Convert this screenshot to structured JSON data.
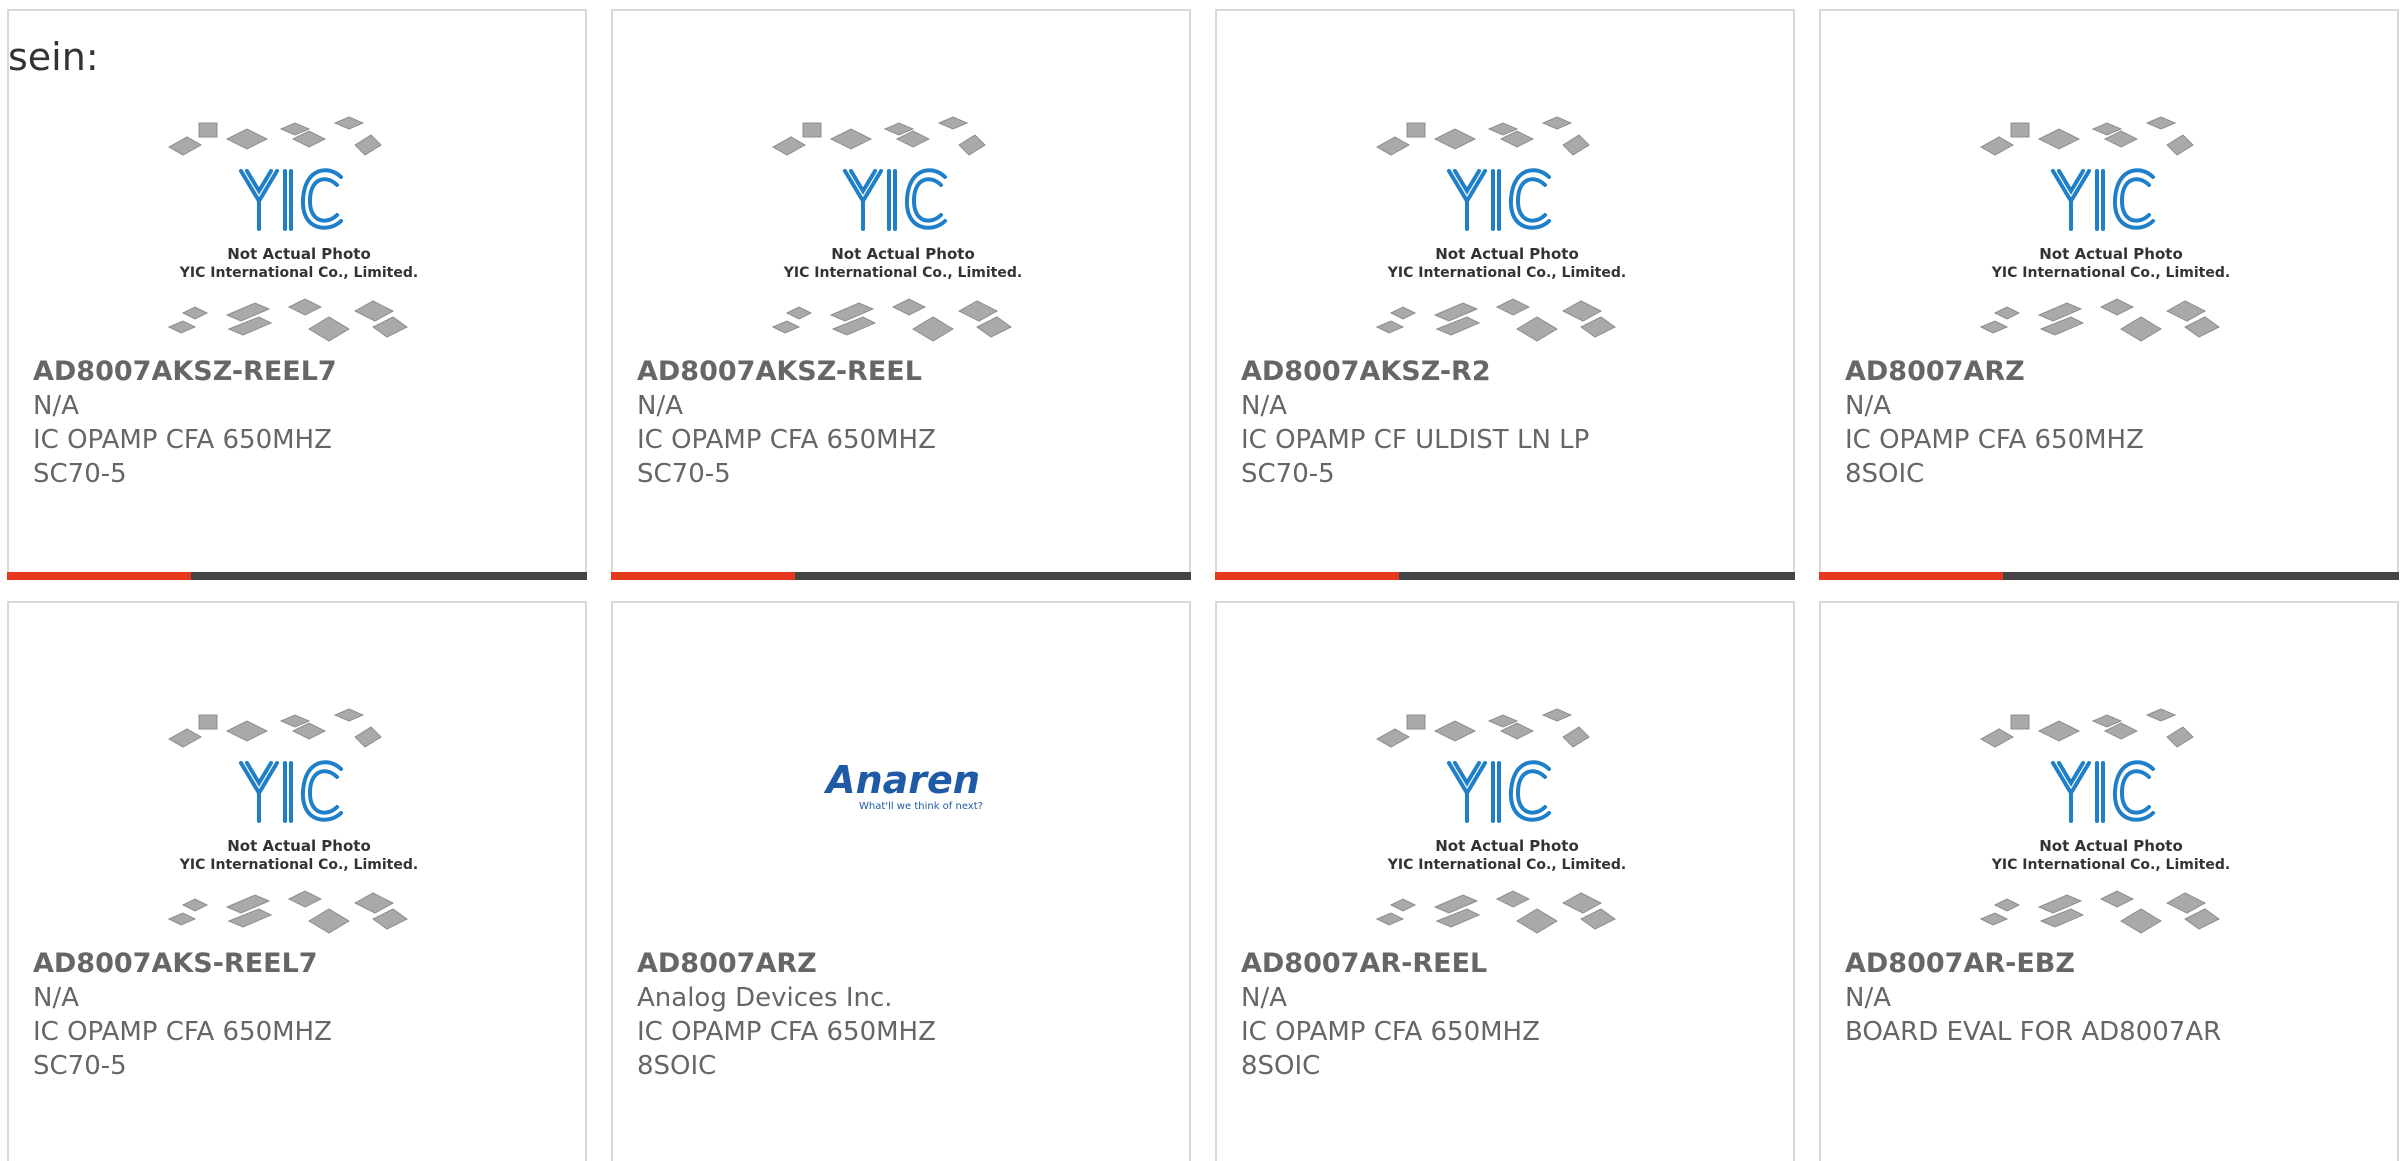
{
  "intro_text": "sein:",
  "accent_color": "#e8391c",
  "bar_color": "#444444",
  "placeholder": {
    "line1": "Not Actual Photo",
    "line2": "YIC International Co., Limited.",
    "logo": "YIC"
  },
  "anaren": {
    "logo": "Anaren",
    "tagline": "What'll we think of next?"
  },
  "products": [
    {
      "part": "AD8007AKSZ-REEL7",
      "manufacturer": "N/A",
      "description": "IC OPAMP CFA 650MHZ SC70-5",
      "image": "yic-placeholder"
    },
    {
      "part": "AD8007AKSZ-REEL",
      "manufacturer": "N/A",
      "description": "IC OPAMP CFA 650MHZ SC70-5",
      "image": "yic-placeholder"
    },
    {
      "part": "AD8007AKSZ-R2",
      "manufacturer": "N/A",
      "description": "IC OPAMP CF ULDIST LN LP SC70-5",
      "image": "yic-placeholder"
    },
    {
      "part": "AD8007ARZ",
      "manufacturer": "N/A",
      "description": "IC OPAMP CFA 650MHZ 8SOIC",
      "image": "yic-placeholder"
    },
    {
      "part": "AD8007AKS-REEL7",
      "manufacturer": "N/A",
      "description": "IC OPAMP CFA 650MHZ SC70-5",
      "image": "yic-placeholder"
    },
    {
      "part": "AD8007ARZ",
      "manufacturer": "Analog Devices Inc.",
      "description": "IC OPAMP CFA 650MHZ 8SOIC",
      "image": "anaren-logo"
    },
    {
      "part": "AD8007AR-REEL",
      "manufacturer": "N/A",
      "description": "IC OPAMP CFA 650MHZ 8SOIC",
      "image": "yic-placeholder"
    },
    {
      "part": "AD8007AR-EBZ",
      "manufacturer": "N/A",
      "description": "BOARD EVAL FOR AD8007AR",
      "image": "yic-placeholder"
    }
  ]
}
